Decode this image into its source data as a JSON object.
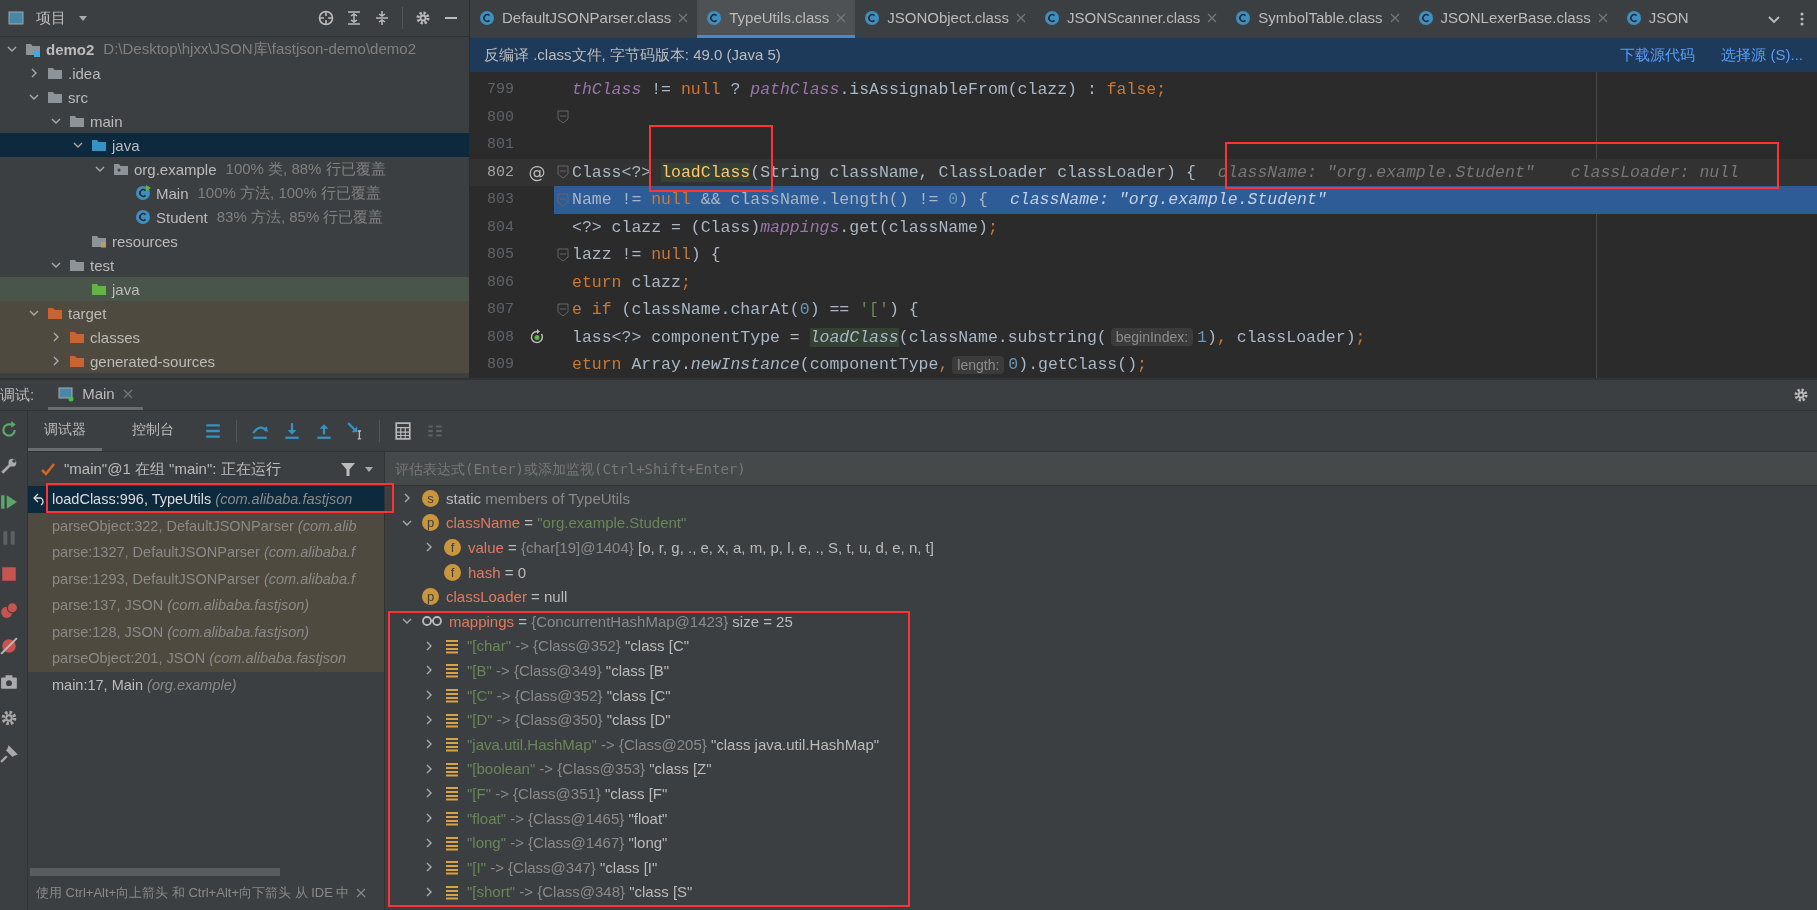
{
  "project_panel": {
    "title": "项目",
    "tree": [
      {
        "label": "demo2",
        "note": "D:\\Desktop\\hjxx\\JSON库\\fastjson-demo\\demo2",
        "kind": "module",
        "expanded": true,
        "selected": false,
        "children": [
          {
            "label": ".idea",
            "kind": "folder",
            "expanded": false,
            "selected": false
          },
          {
            "label": "src",
            "kind": "folder",
            "expanded": true,
            "selected": false,
            "children": [
              {
                "label": "main",
                "kind": "folder",
                "expanded": true,
                "selected": false,
                "children": [
                  {
                    "label": "java",
                    "kind": "source",
                    "expanded": true,
                    "selected": true,
                    "children": [
                      {
                        "label": "org.example",
                        "note": "100% 类, 88% 行已覆盖",
                        "kind": "package",
                        "expanded": true,
                        "selected": false,
                        "children": [
                          {
                            "label": "Main",
                            "note": "100% 方法, 100% 行已覆盖",
                            "kind": "main-class",
                            "selected": false
                          },
                          {
                            "label": "Student",
                            "note": "83% 方法, 85% 行已覆盖",
                            "kind": "class",
                            "selected": false
                          }
                        ]
                      }
                    ]
                  },
                  {
                    "label": "resources",
                    "kind": "resources",
                    "selected": false
                  }
                ]
              },
              {
                "label": "test",
                "kind": "folder",
                "expanded": true,
                "selected": false,
                "children": [
                  {
                    "label": "java",
                    "kind": "test-source",
                    "selected": false
                  }
                ]
              }
            ]
          },
          {
            "label": "target",
            "kind": "excluded",
            "expanded": true,
            "selected": false,
            "children": [
              {
                "label": "classes",
                "kind": "excluded",
                "expanded": false,
                "selected": false
              },
              {
                "label": "generated-sources",
                "kind": "excluded",
                "expanded": false,
                "selected": false
              }
            ]
          }
        ]
      }
    ]
  },
  "editor": {
    "tabs": [
      {
        "label": "DefaultJSONParser.class",
        "selected": false,
        "closable": true
      },
      {
        "label": "TypeUtils.class",
        "selected": true,
        "closable": true
      },
      {
        "label": "JSONObject.class",
        "selected": false,
        "closable": true
      },
      {
        "label": "JSONScanner.class",
        "selected": false,
        "closable": true
      },
      {
        "label": "SymbolTable.class",
        "selected": false,
        "closable": true
      },
      {
        "label": "JSONLexerBase.class",
        "selected": false,
        "closable": true
      },
      {
        "label": "JSON",
        "selected": false,
        "closable": false
      }
    ],
    "banner": {
      "text": "反编译 .class文件, 字节码版本: 49.0 (Java 5)",
      "links": [
        "下载源代码",
        "选择源 (S)..."
      ]
    },
    "lines": [
      {
        "number": "799",
        "fold": false,
        "current": false,
        "highlighted": false,
        "segments": [
          {
            "text": "thClass",
            "kind": "field"
          },
          {
            "text": " != ",
            "kind": "plain"
          },
          {
            "text": "null",
            "kind": "kw"
          },
          {
            "text": " ? ",
            "kind": "plain"
          },
          {
            "text": "pathClass",
            "kind": "field"
          },
          {
            "text": ".isAssignableFrom(clazz) : ",
            "kind": "plain"
          },
          {
            "text": "false;",
            "kind": "kw"
          }
        ]
      },
      {
        "number": "800",
        "fold": true,
        "current": false,
        "highlighted": false
      },
      {
        "number": "801",
        "fold": false,
        "current": false,
        "highlighted": false
      },
      {
        "number": "802",
        "gutter_text": "@",
        "fold": true,
        "current": true,
        "highlighted": false,
        "segments": [
          {
            "text": "Class<?> ",
            "kind": "plain"
          },
          {
            "text": "loadClass",
            "kind": "method"
          },
          {
            "text": "(String className, ClassLoader classLoader) {",
            "kind": "plain"
          },
          {
            "text": "className: \"org.example.Student\"",
            "kind": "hint"
          },
          {
            "text": "classLoader: null",
            "kind": "hint"
          }
        ]
      },
      {
        "number": "803",
        "fold": true,
        "current": false,
        "highlighted": true,
        "segments": [
          {
            "text": "Name != ",
            "kind": "plain"
          },
          {
            "text": "null",
            "kind": "kw"
          },
          {
            "text": " && className.length() != ",
            "kind": "plain"
          },
          {
            "text": "0",
            "kind": "num"
          },
          {
            "text": ") {",
            "kind": "plain"
          },
          {
            "text": "className: \"org.example.Student\"",
            "kind": "hint"
          }
        ]
      },
      {
        "number": "804",
        "fold": false,
        "current": false,
        "highlighted": false,
        "segments": [
          {
            "text": "<?> clazz = (Class)",
            "kind": "plain"
          },
          {
            "text": "mappings",
            "kind": "field"
          },
          {
            "text": ".get(className)",
            "kind": "plain"
          },
          {
            "text": ";",
            "kind": "kw"
          }
        ]
      },
      {
        "number": "805",
        "fold": true,
        "current": false,
        "highlighted": false,
        "segments": [
          {
            "text": "lazz != ",
            "kind": "plain"
          },
          {
            "text": "null",
            "kind": "kw"
          },
          {
            "text": ") {",
            "kind": "plain"
          }
        ]
      },
      {
        "number": "806",
        "fold": false,
        "current": false,
        "highlighted": false,
        "segments": [
          {
            "text": "eturn",
            "kind": "kw"
          },
          {
            "text": " clazz",
            "kind": "plain"
          },
          {
            "text": ";",
            "kind": "kw"
          }
        ]
      },
      {
        "number": "807",
        "fold": true,
        "current": false,
        "highlighted": false,
        "segments": [
          {
            "text": "e if",
            "kind": "kw"
          },
          {
            "text": " (className.charAt(",
            "kind": "plain"
          },
          {
            "text": "0",
            "kind": "num"
          },
          {
            "text": ") == ",
            "kind": "plain"
          },
          {
            "text": "'['",
            "kind": "str"
          },
          {
            "text": ") {",
            "kind": "plain"
          }
        ]
      },
      {
        "number": "808",
        "kind": "recursion",
        "fold": false,
        "current": false,
        "highlighted": false,
        "segments": [
          {
            "text": "lass<?> componentType = ",
            "kind": "plain"
          },
          {
            "text": "loadClass",
            "kind": "call"
          },
          {
            "text": "(className.substring(",
            "kind": "plain"
          },
          {
            "text": "beginIndex:",
            "kind": "param"
          },
          {
            "text": "1",
            "kind": "num"
          },
          {
            "text": ")",
            "kind": "plain"
          },
          {
            "text": ",",
            "kind": "kw"
          },
          {
            "text": " classLoader)",
            "kind": "plain"
          },
          {
            "text": ";",
            "kind": "kw"
          }
        ]
      },
      {
        "number": "809",
        "fold": false,
        "current": false,
        "highlighted": false,
        "segments": [
          {
            "text": "eturn",
            "kind": "kw"
          },
          {
            "text": " Array.",
            "kind": "plain"
          },
          {
            "text": "newInstance",
            "kind": "italic"
          },
          {
            "text": "(componentType",
            "kind": "plain"
          },
          {
            "text": ",",
            "kind": "kw"
          },
          {
            "text": "length:",
            "kind": "param"
          },
          {
            "text": "0",
            "kind": "num"
          },
          {
            "text": ").getClass()",
            "kind": "plain"
          },
          {
            "text": ";",
            "kind": "kw"
          }
        ]
      }
    ]
  },
  "debug": {
    "title": "调试:",
    "session": "Main",
    "tabs": [
      {
        "label": "调试器",
        "selected": true
      },
      {
        "label": "控制台",
        "selected": false
      }
    ],
    "thread": "\"main\"@1 在组 \"main\": 正在运行",
    "frames": [
      {
        "method": "loadClass:996, TypeUtils",
        "package": "(com.alibaba.fastjson",
        "library": false,
        "selected": true
      },
      {
        "method": "parseObject:322, DefaultJSONParser",
        "package": "(com.alib",
        "library": true,
        "selected": false
      },
      {
        "method": "parse:1327, DefaultJSONParser",
        "package": "(com.alibaba.f",
        "library": true,
        "selected": false
      },
      {
        "method": "parse:1293, DefaultJSONParser",
        "package": "(com.alibaba.f",
        "library": true,
        "selected": false
      },
      {
        "method": "parse:137, JSON",
        "package": "(com.alibaba.fastjson)",
        "library": true,
        "selected": false
      },
      {
        "method": "parse:128, JSON",
        "package": "(com.alibaba.fastjson)",
        "library": true,
        "selected": false
      },
      {
        "method": "parseObject:201, JSON",
        "package": "(com.alibaba.fastjson",
        "library": true,
        "selected": false
      },
      {
        "method": "main:17, Main",
        "package": "(org.example)",
        "library": false,
        "selected": false
      }
    ],
    "hint": "使用 Ctrl+Alt+向上箭头 和 Ctrl+Alt+向下箭头 从 IDE 中",
    "eval_placeholder": "评估表达式(Enter)或添加监视(Ctrl+Shift+Enter)",
    "variables": [
      {
        "kind": "static",
        "badge": "s",
        "expanded": false,
        "segments": [
          {
            "text": "static",
            "kind": "plain"
          },
          {
            "text": " members of TypeUtils",
            "kind": "grey"
          }
        ]
      },
      {
        "kind": "param",
        "badge": "p",
        "expanded": true,
        "segments": [
          {
            "text": "className",
            "kind": "name"
          },
          {
            "text": " = ",
            "kind": "plain"
          },
          {
            "text": "\"org.example.Student\"",
            "kind": "string"
          }
        ],
        "children": [
          {
            "kind": "field",
            "badge": "f",
            "expanded": false,
            "segments": [
              {
                "text": "value",
                "kind": "name"
              },
              {
                "text": " = ",
                "kind": "plain"
              },
              {
                "text": "{char[19]@1404}",
                "kind": "grey"
              },
              {
                "text": " [o, r, g, ., e, x, a, m, p, l, e, ., S, t, u, d, e, n, t]",
                "kind": "plain"
              }
            ]
          },
          {
            "kind": "field",
            "badge": "f",
            "segments": [
              {
                "text": "hash",
                "kind": "name"
              },
              {
                "text": " = 0",
                "kind": "plain"
              }
            ]
          }
        ]
      },
      {
        "kind": "param",
        "badge": "p",
        "segments": [
          {
            "text": "classLoader",
            "kind": "name"
          },
          {
            "text": " = null",
            "kind": "plain"
          }
        ]
      },
      {
        "kind": "watch",
        "expanded": true,
        "segments": [
          {
            "text": "mappings",
            "kind": "name"
          },
          {
            "text": " = ",
            "kind": "plain"
          },
          {
            "text": "{ConcurrentHashMap@1423}",
            "kind": "grey"
          },
          {
            "text": "  size = 25",
            "kind": "plain"
          }
        ],
        "children": [
          {
            "kind": "entry",
            "expanded": false,
            "segments": [
              {
                "text": "\"[char\"",
                "kind": "string"
              },
              {
                "text": " -> {Class@352}",
                "kind": "grey"
              },
              {
                "text": " \"class [C\"",
                "kind": "plain"
              }
            ]
          },
          {
            "kind": "entry",
            "expanded": false,
            "segments": [
              {
                "text": "\"[B\"",
                "kind": "string"
              },
              {
                "text": " -> {Class@349}",
                "kind": "grey"
              },
              {
                "text": " \"class [B\"",
                "kind": "plain"
              }
            ]
          },
          {
            "kind": "entry",
            "expanded": false,
            "segments": [
              {
                "text": "\"[C\"",
                "kind": "string"
              },
              {
                "text": " -> {Class@352}",
                "kind": "grey"
              },
              {
                "text": " \"class [C\"",
                "kind": "plain"
              }
            ]
          },
          {
            "kind": "entry",
            "expanded": false,
            "segments": [
              {
                "text": "\"[D\"",
                "kind": "string"
              },
              {
                "text": " -> {Class@350}",
                "kind": "grey"
              },
              {
                "text": " \"class [D\"",
                "kind": "plain"
              }
            ]
          },
          {
            "kind": "entry",
            "expanded": false,
            "segments": [
              {
                "text": "\"java.util.HashMap\"",
                "kind": "string"
              },
              {
                "text": " -> {Class@205}",
                "kind": "grey"
              },
              {
                "text": " \"class java.util.HashMap\"",
                "kind": "plain"
              }
            ]
          },
          {
            "kind": "entry",
            "expanded": false,
            "segments": [
              {
                "text": "\"[boolean\"",
                "kind": "string"
              },
              {
                "text": " -> {Class@353}",
                "kind": "grey"
              },
              {
                "text": " \"class [Z\"",
                "kind": "plain"
              }
            ]
          },
          {
            "kind": "entry",
            "expanded": false,
            "segments": [
              {
                "text": "\"[F\"",
                "kind": "string"
              },
              {
                "text": " -> {Class@351}",
                "kind": "grey"
              },
              {
                "text": " \"class [F\"",
                "kind": "plain"
              }
            ]
          },
          {
            "kind": "entry",
            "expanded": false,
            "segments": [
              {
                "text": "\"float\"",
                "kind": "string"
              },
              {
                "text": " -> {Class@1465}",
                "kind": "grey"
              },
              {
                "text": " \"float\"",
                "kind": "plain"
              }
            ]
          },
          {
            "kind": "entry",
            "expanded": false,
            "segments": [
              {
                "text": "\"long\"",
                "kind": "string"
              },
              {
                "text": " -> {Class@1467}",
                "kind": "grey"
              },
              {
                "text": " \"long\"",
                "kind": "plain"
              }
            ]
          },
          {
            "kind": "entry",
            "expanded": false,
            "segments": [
              {
                "text": "\"[I\"",
                "kind": "string"
              },
              {
                "text": " -> {Class@347}",
                "kind": "grey"
              },
              {
                "text": " \"class [I\"",
                "kind": "plain"
              }
            ]
          },
          {
            "kind": "entry",
            "expanded": false,
            "segments": [
              {
                "text": "\"[short\"",
                "kind": "string"
              },
              {
                "text": " -> {Class@348}",
                "kind": "grey"
              },
              {
                "text": " \"class [S\"",
                "kind": "plain"
              }
            ]
          }
        ]
      }
    ]
  }
}
